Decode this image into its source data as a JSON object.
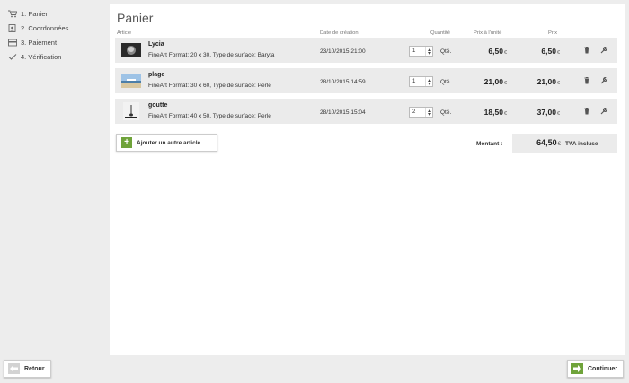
{
  "steps": [
    {
      "label": "1. Panier",
      "icon": "cart-icon"
    },
    {
      "label": "2. Coordonnées",
      "icon": "address-card-icon"
    },
    {
      "label": "3. Paiement",
      "icon": "credit-card-icon"
    },
    {
      "label": "4. Vérification",
      "icon": "checkmark-icon"
    }
  ],
  "page": {
    "title": "Panier"
  },
  "table": {
    "headers": {
      "article": "Article",
      "date": "Date de création",
      "quantity": "Quantité",
      "unit_price": "Prix à l'unité",
      "price": "Prix"
    },
    "qty_suffix": "Qté.",
    "currency": "€",
    "rows": [
      {
        "name": "Lycia",
        "description": "FineArt Format: 20 x 30, Type de surface: Baryta",
        "date": "23/10/2015 21:00",
        "quantity": "1",
        "unit_price": "6,50",
        "price": "6,50"
      },
      {
        "name": "plage",
        "description": "FineArt Format: 30 x 60, Type de surface: Perle",
        "date": "28/10/2015 14:59",
        "quantity": "1",
        "unit_price": "21,00",
        "price": "21,00"
      },
      {
        "name": "goutte",
        "description": "FineArt Format: 40 x 50, Type de surface: Perle",
        "date": "28/10/2015 15:04",
        "quantity": "2",
        "unit_price": "18,50",
        "price": "37,00"
      }
    ]
  },
  "add_button": {
    "label": "Ajouter un autre article",
    "icon": "plus-icon"
  },
  "total": {
    "label": "Montant :",
    "amount": "64,50",
    "currency": "€",
    "tax_note": "TVA incluse"
  },
  "nav": {
    "back_label": "Retour",
    "next_label": "Continuer"
  },
  "colors": {
    "accent_green": "#6fa33a",
    "row_bg": "#ebebeb",
    "page_bg": "#ededed"
  }
}
